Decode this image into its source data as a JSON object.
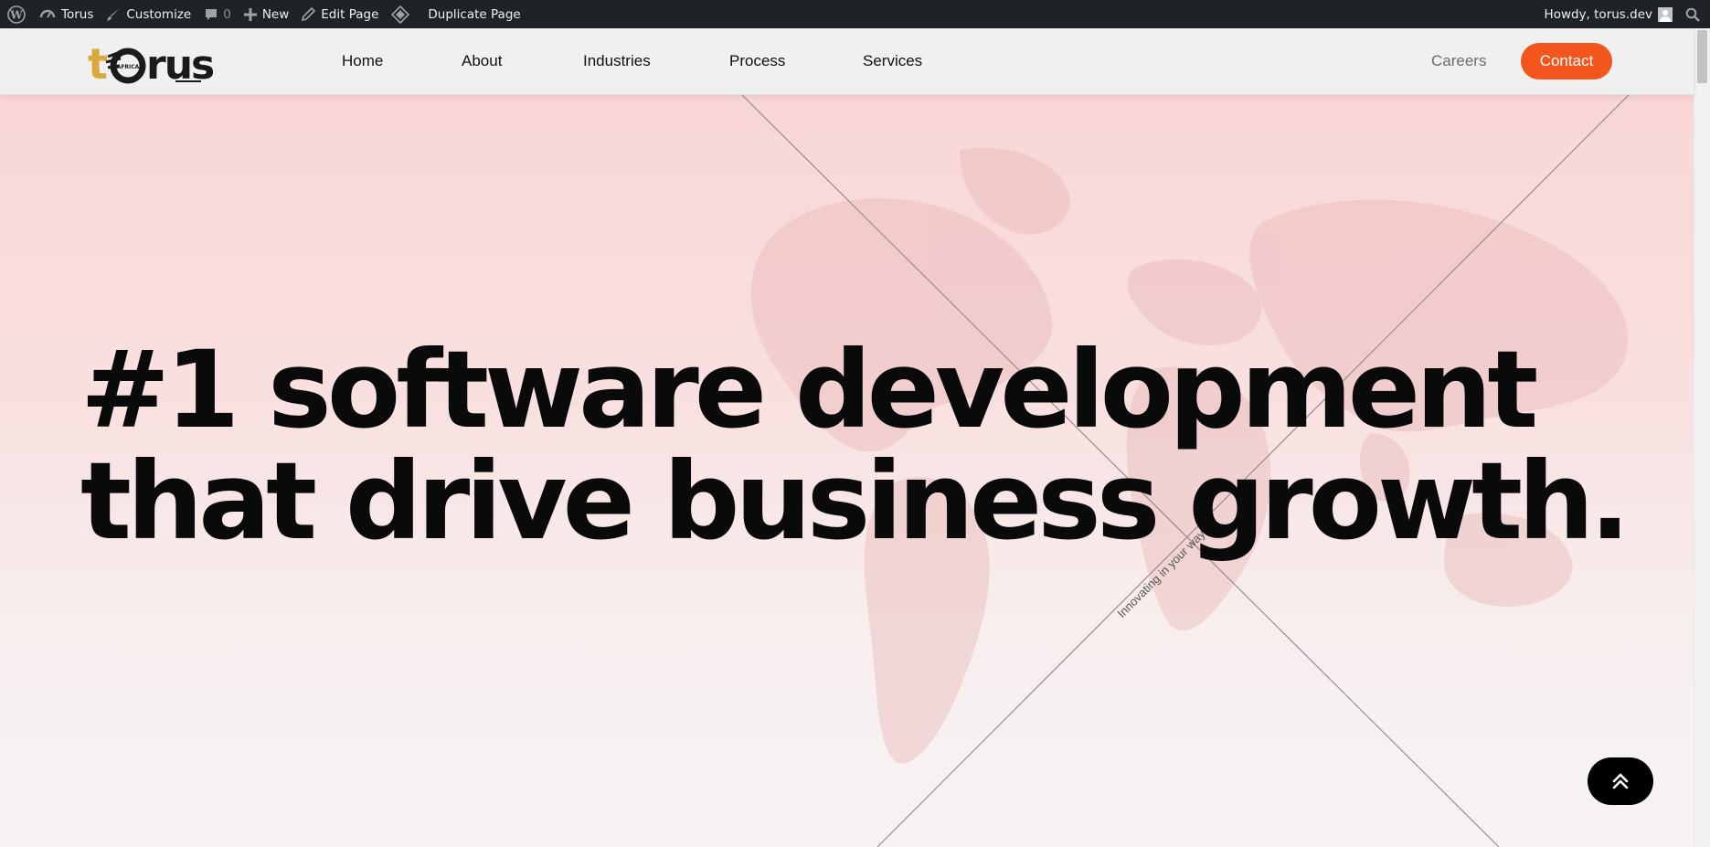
{
  "admin_bar": {
    "site_name": "Torus",
    "customize": "Customize",
    "comments_count": "0",
    "new": "New",
    "edit_page": "Edit Page",
    "duplicate_page": "Duplicate Page",
    "howdy": "Howdy, torus.dev"
  },
  "header": {
    "logo": "torus",
    "logo_badge": "AFRICA",
    "nav": [
      "Home",
      "About",
      "Industries",
      "Process",
      "Services"
    ],
    "careers": "Careers",
    "contact": "Contact"
  },
  "hero": {
    "title_line1": "#1 software development",
    "title_line2": "that drive business growth.",
    "tagline": "Innovating in your way"
  },
  "colors": {
    "accent": "#f2561c",
    "logo_gold": "#d9a93a",
    "adminbar": "#1d2327"
  },
  "icons": {
    "wordpress": "wordpress-icon",
    "dashboard": "dashboard-icon",
    "brush": "brush-icon",
    "comment": "comment-icon",
    "plus": "plus-icon",
    "pencil": "pencil-icon",
    "duplicate": "duplicate-icon",
    "search": "search-icon",
    "back_to_top": "double-chevron-up-icon"
  }
}
